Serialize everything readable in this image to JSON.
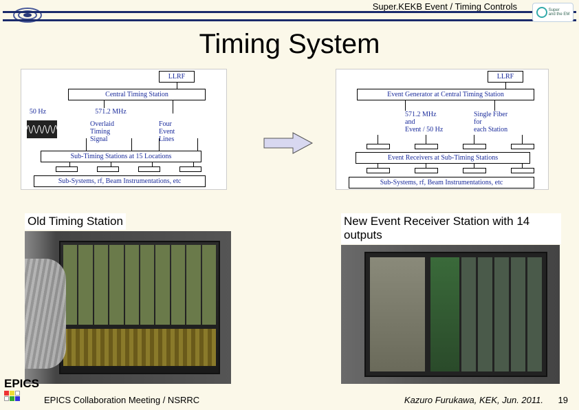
{
  "header": {
    "breadcrumb": "Super.KEKB Event / Timing Controls",
    "title": "Timing System"
  },
  "arrow": {
    "name": "transition-arrow"
  },
  "diagram_left": {
    "llrf": "LLRF",
    "central": "Central Timing Station",
    "freq1": "50 Hz",
    "freq2": "571.2 MHz",
    "overlaid": "Overlaid\nTiming\nSignal",
    "four": "Four\nEvent\nLines",
    "sub15": "Sub-Timing Stations at 15 Locations",
    "subsys": "Sub-Systems, rf, Beam Instrumentations, etc"
  },
  "diagram_right": {
    "llrf": "LLRF",
    "evgen": "Event Generator at Central Timing Station",
    "freq": "571.2 MHz\nand\nEvent / 50 Hz",
    "fiber": "Single Fiber\nfor\neach Station",
    "evrcv": "Event Receivers at Sub-Timing Stations",
    "subsys": "Sub-Systems, rf, Beam Instrumentations, etc"
  },
  "captions": {
    "old": "Old Timing Station",
    "newer": "New Event Receiver Station with 14 outputs"
  },
  "footer": {
    "epics": "EPICS",
    "meeting": "EPICS Collaboration Meeting / NSRRC",
    "author": "Kazuro Furukawa, KEK, Jun. 2011.",
    "page": "19"
  }
}
